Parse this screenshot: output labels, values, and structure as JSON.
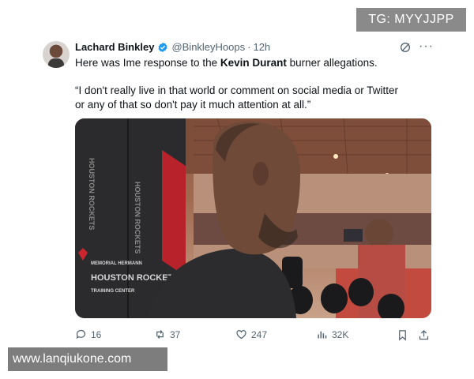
{
  "watermarks": {
    "top": "TG: MYYJJPP",
    "bottom": "www.lanqiukone.com"
  },
  "tweet": {
    "author_name": "Lachard Binkley",
    "handle": "@BinkleyHoops",
    "separator": "·",
    "time": "12h",
    "text_before": "Here was Ime response to the ",
    "text_bold": "Kevin Durant",
    "text_after": " burner allegations.",
    "quote": "“I don't really live in that world or comment on social media or Twitter or any of that so don't pay it much attention at all.”"
  },
  "actions": {
    "replies": "16",
    "reposts": "37",
    "likes": "247",
    "views": "32K"
  },
  "media": {
    "background_text": [
      "MEMORIAL HERMANN",
      "HOUSTON ROCKETS",
      "TRAINING CENTER"
    ]
  },
  "colors": {
    "verified": "#1d9bf0",
    "secondary_text": "#536471"
  }
}
